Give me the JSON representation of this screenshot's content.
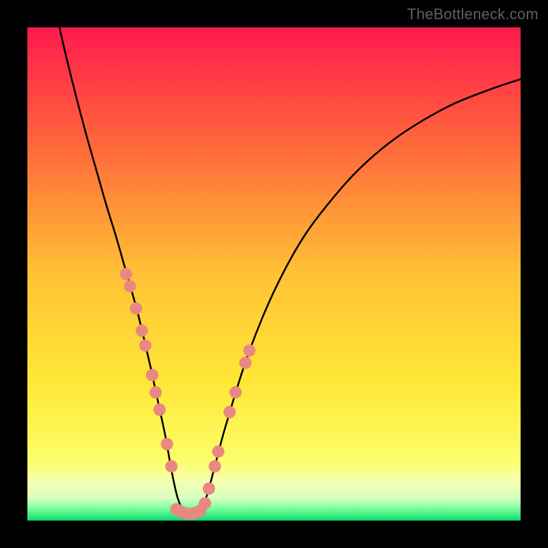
{
  "watermark": "TheBottleneck.com",
  "chart_data": {
    "type": "line",
    "title": "",
    "xlabel": "",
    "ylabel": "",
    "xlim": [
      0,
      100
    ],
    "ylim": [
      0,
      100
    ],
    "background_gradient": {
      "stops": [
        {
          "pos": 0.0,
          "color": "#ff1a4d"
        },
        {
          "pos": 0.25,
          "color": "#ff6b3a"
        },
        {
          "pos": 0.5,
          "color": "#ffc236"
        },
        {
          "pos": 0.72,
          "color": "#ffe736"
        },
        {
          "pos": 0.88,
          "color": "#fbff6a"
        },
        {
          "pos": 0.92,
          "color": "#f5ffb0"
        },
        {
          "pos": 0.955,
          "color": "#d7ffbf"
        },
        {
          "pos": 0.975,
          "color": "#7cff9f"
        },
        {
          "pos": 1.0,
          "color": "#0bd96b"
        }
      ]
    },
    "series": [
      {
        "name": "bottleneck-curve",
        "x": [
          6.5,
          8,
          10,
          12,
          14,
          16,
          18,
          20,
          22,
          23.5,
          25,
          26.5,
          28,
          29.25,
          30.5,
          32,
          34,
          36,
          38,
          40,
          44,
          48,
          52,
          56,
          60,
          66,
          72,
          78,
          86,
          94,
          100
        ],
        "y": [
          100,
          93.5,
          85.5,
          78,
          71,
          64,
          57.5,
          50.5,
          43.5,
          37.5,
          31,
          24,
          17,
          10,
          4.5,
          1.5,
          1.4,
          4,
          11,
          18.5,
          31.5,
          42,
          50.5,
          57.5,
          63,
          70,
          75.5,
          79.8,
          84.3,
          87.5,
          89.5
        ]
      }
    ],
    "markers": [
      {
        "name": "left-cluster",
        "color": "#e98883",
        "points": [
          {
            "x": 20.0,
            "y": 50.0
          },
          {
            "x": 20.8,
            "y": 47.5
          },
          {
            "x": 22.0,
            "y": 43.0
          },
          {
            "x": 23.2,
            "y": 38.5
          },
          {
            "x": 23.9,
            "y": 35.5
          },
          {
            "x": 25.3,
            "y": 29.5
          },
          {
            "x": 26.0,
            "y": 26.0
          },
          {
            "x": 26.8,
            "y": 22.5
          },
          {
            "x": 28.3,
            "y": 15.5
          },
          {
            "x": 29.2,
            "y": 11.0
          }
        ]
      },
      {
        "name": "right-cluster",
        "color": "#e98883",
        "points": [
          {
            "x": 36.0,
            "y": 3.5
          },
          {
            "x": 36.8,
            "y": 6.5
          },
          {
            "x": 38.0,
            "y": 11.0
          },
          {
            "x": 38.7,
            "y": 14.0
          },
          {
            "x": 41.0,
            "y": 22.0
          },
          {
            "x": 42.2,
            "y": 26.0
          },
          {
            "x": 44.2,
            "y": 32.0
          },
          {
            "x": 45.0,
            "y": 34.5
          }
        ]
      },
      {
        "name": "bottom-cluster",
        "color": "#e98883",
        "points": [
          {
            "x": 30.2,
            "y": 2.3
          },
          {
            "x": 31.4,
            "y": 1.7
          },
          {
            "x": 32.6,
            "y": 1.4
          },
          {
            "x": 33.8,
            "y": 1.5
          },
          {
            "x": 35.0,
            "y": 2.0
          }
        ]
      }
    ]
  }
}
